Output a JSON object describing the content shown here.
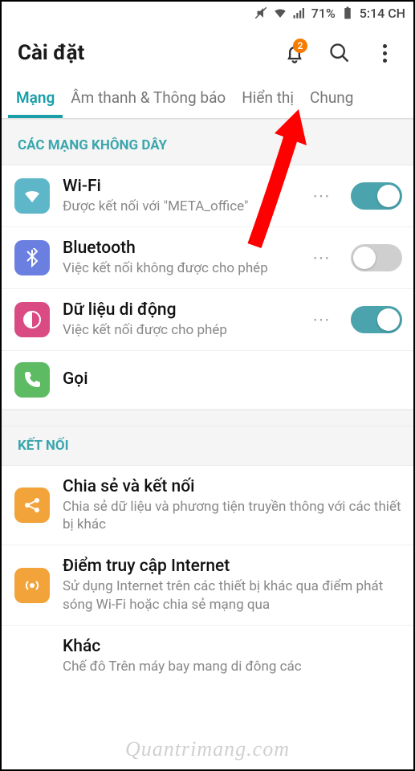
{
  "status": {
    "battery_pct": "71%",
    "time": "5:14 CH"
  },
  "header": {
    "title": "Cài đặt",
    "notif_count": "2"
  },
  "tabs": [
    {
      "label": "Mạng",
      "active": true
    },
    {
      "label": "Âm thanh & Thông báo",
      "active": false
    },
    {
      "label": "Hiển thị",
      "active": false
    },
    {
      "label": "Chung",
      "active": false
    }
  ],
  "sections": {
    "wireless_header": "CÁC MẠNG KHÔNG DÂY",
    "connect_header": "KẾT NỐI"
  },
  "items": {
    "wifi": {
      "title": "Wi-Fi",
      "sub": "Được kết nối với \"META_office\"",
      "on": true
    },
    "bt": {
      "title": "Bluetooth",
      "sub": "Việc kết nối không được cho phép",
      "on": false
    },
    "data": {
      "title": "Dữ liệu di động",
      "sub": "Việc kết nối được cho phép",
      "on": true
    },
    "call": {
      "title": "Gọi"
    },
    "share": {
      "title": "Chia sẻ và kết nối",
      "sub": "Chia sẻ dữ liệu và phương tiện truyền thông với các thiết bị khác"
    },
    "tether": {
      "title": "Điểm truy cập Internet",
      "sub": "Sử dụng Internet trên các thiết bị khác qua điểm phát sóng Wi-Fi hoặc chia sẻ mạng qua"
    },
    "other": {
      "title": "Khác",
      "sub": "Chế đô Trên máy bay mang di đông các"
    }
  },
  "watermark": "Quantrimang.com"
}
